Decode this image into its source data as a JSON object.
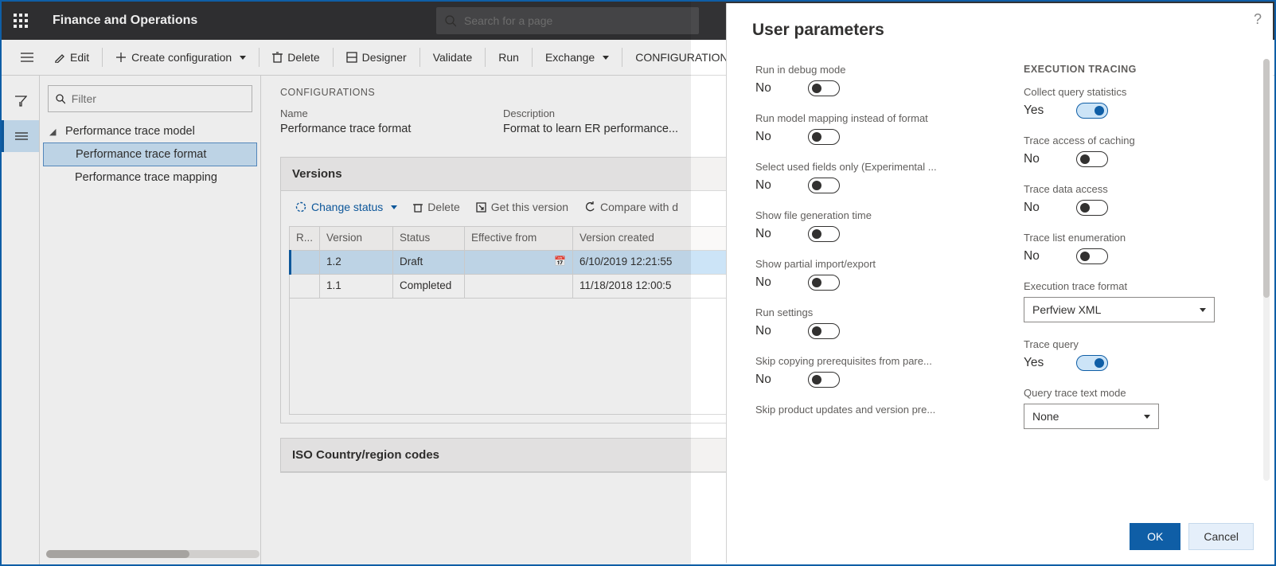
{
  "app_title": "Finance and Operations",
  "search_placeholder": "Search for a page",
  "toolbar": {
    "edit": "Edit",
    "create": "Create configuration",
    "delete": "Delete",
    "designer": "Designer",
    "validate": "Validate",
    "run": "Run",
    "exchange": "Exchange",
    "configurations": "CONFIGURATION"
  },
  "filter_placeholder": "Filter",
  "tree": {
    "root": "Performance trace model",
    "children": [
      "Performance trace format",
      "Performance trace mapping"
    ]
  },
  "configs": {
    "heading": "CONFIGURATIONS",
    "name_label": "Name",
    "name_value": "Performance trace format",
    "desc_label": "Description",
    "desc_value": "Format to learn ER performance..."
  },
  "versions": {
    "heading": "Versions",
    "change_status": "Change status",
    "delete": "Delete",
    "get_version": "Get this version",
    "compare": "Compare with d",
    "cols": {
      "r": "R...",
      "version": "Version",
      "status": "Status",
      "eff": "Effective from",
      "created": "Version created"
    },
    "rows": [
      {
        "version": "1.2",
        "status": "Draft",
        "eff": "",
        "created": "6/10/2019 12:21:55"
      },
      {
        "version": "1.1",
        "status": "Completed",
        "eff": "",
        "created": "11/18/2018 12:00:5"
      }
    ]
  },
  "iso_heading": "ISO Country/region codes",
  "modal": {
    "title": "User parameters",
    "left": [
      {
        "label": "Run in debug mode",
        "value": "No",
        "on": false
      },
      {
        "label": "Run model mapping instead of format",
        "value": "No",
        "on": false
      },
      {
        "label": "Select used fields only (Experimental ...",
        "value": "No",
        "on": false
      },
      {
        "label": "Show file generation time",
        "value": "No",
        "on": false
      },
      {
        "label": "Show partial import/export",
        "value": "No",
        "on": false
      },
      {
        "label": "Run settings",
        "value": "No",
        "on": false
      },
      {
        "label": "Skip copying prerequisites from pare...",
        "value": "No",
        "on": false
      },
      {
        "label": "Skip product updates and version pre...",
        "value": "",
        "on": false
      }
    ],
    "right_heading": "EXECUTION TRACING",
    "right_toggles": [
      {
        "label": "Collect query statistics",
        "value": "Yes",
        "on": true
      },
      {
        "label": "Trace access of caching",
        "value": "No",
        "on": false
      },
      {
        "label": "Trace data access",
        "value": "No",
        "on": false
      },
      {
        "label": "Trace list enumeration",
        "value": "No",
        "on": false
      }
    ],
    "exec_format_label": "Execution trace format",
    "exec_format_value": "Perfview XML",
    "trace_query": {
      "label": "Trace query",
      "value": "Yes",
      "on": true
    },
    "qtext_label": "Query trace text mode",
    "qtext_value": "None",
    "ok": "OK",
    "cancel": "Cancel"
  }
}
